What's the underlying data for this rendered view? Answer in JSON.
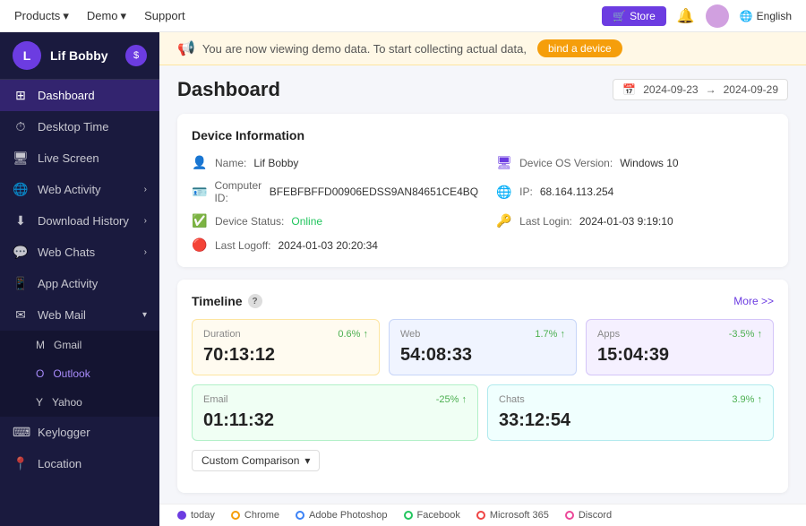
{
  "topnav": {
    "products_label": "Products",
    "demo_label": "Demo",
    "support_label": "Support",
    "store_label": "Store",
    "language": "English"
  },
  "sidebar": {
    "user_name": "Lif Bobby",
    "items": [
      {
        "id": "dashboard",
        "label": "Dashboard",
        "icon": "⊞",
        "active": true
      },
      {
        "id": "desktop-time",
        "label": "Desktop Time",
        "icon": "🕐"
      },
      {
        "id": "live-screen",
        "label": "Live Screen",
        "icon": "🖥"
      },
      {
        "id": "web-activity",
        "label": "Web Activity",
        "icon": "🌐",
        "has_arrow": true
      },
      {
        "id": "download-history",
        "label": "Download History",
        "icon": "⬇",
        "has_arrow": true
      },
      {
        "id": "web-chats",
        "label": "Web Chats",
        "icon": "💬",
        "has_arrow": true
      },
      {
        "id": "app-activity",
        "label": "App Activity",
        "icon": "📱"
      },
      {
        "id": "web-mail",
        "label": "Web Mail",
        "icon": "✉",
        "has_arrow": true,
        "expanded": true
      },
      {
        "id": "keylogger",
        "label": "Keylogger",
        "icon": "⌨"
      },
      {
        "id": "location",
        "label": "Location",
        "icon": "📍"
      }
    ],
    "sub_items": [
      {
        "id": "gmail",
        "label": "Gmail"
      },
      {
        "id": "outlook",
        "label": "Outlook",
        "active": true
      },
      {
        "id": "yahoo",
        "label": "Yahoo"
      }
    ]
  },
  "banner": {
    "text": "You are now viewing demo data. To start collecting actual data,",
    "btn_label": "bind a device"
  },
  "dashboard": {
    "title": "Dashboard",
    "date_from": "2024-09-23",
    "date_to": "2024-09-29",
    "device_info": {
      "title": "Device Information",
      "name_label": "Name:",
      "name_value": "Lif Bobby",
      "computer_id_label": "Computer ID:",
      "computer_id_value": "BFEBFBFFD00906EDSS9AN84651CE4BQ",
      "device_status_label": "Device Status:",
      "device_status_value": "Online",
      "last_logoff_label": "Last Logoff:",
      "last_logoff_value": "2024-01-03 20:20:34",
      "os_label": "Device OS Version:",
      "os_value": "Windows 10",
      "ip_label": "IP:",
      "ip_value": "68.164.113.254",
      "last_login_label": "Last Login:",
      "last_login_value": "2024-01-03 9:19:10"
    },
    "timeline": {
      "title": "Timeline",
      "more_label": "More >>",
      "cards": [
        {
          "label": "Duration",
          "value": "70:13:12",
          "pct": "0.6%",
          "dir": "up",
          "style": "yellow"
        },
        {
          "label": "Web",
          "value": "54:08:33",
          "pct": "1.7%",
          "dir": "up",
          "style": "blue"
        },
        {
          "label": "Apps",
          "value": "15:04:39",
          "pct": "-3.5%",
          "dir": "up",
          "style": "purple"
        },
        {
          "label": "Email",
          "value": "01:11:32",
          "pct": "-25%",
          "dir": "up",
          "style": "green"
        },
        {
          "label": "Chats",
          "value": "33:12:54",
          "pct": "3.9%",
          "dir": "up",
          "style": "teal"
        }
      ],
      "custom_comparison_label": "Custom Comparison"
    },
    "legend": {
      "items": [
        {
          "label": "today",
          "color": "#6c3ce1"
        },
        {
          "label": "Chrome",
          "color": "#f59e0b"
        },
        {
          "label": "Adobe Photoshop",
          "color": "#3b82f6"
        },
        {
          "label": "Facebook",
          "color": "#22c55e"
        },
        {
          "label": "Microsoft 365",
          "color": "#ef4444"
        },
        {
          "label": "Discord",
          "color": "#ec4899"
        }
      ]
    }
  }
}
